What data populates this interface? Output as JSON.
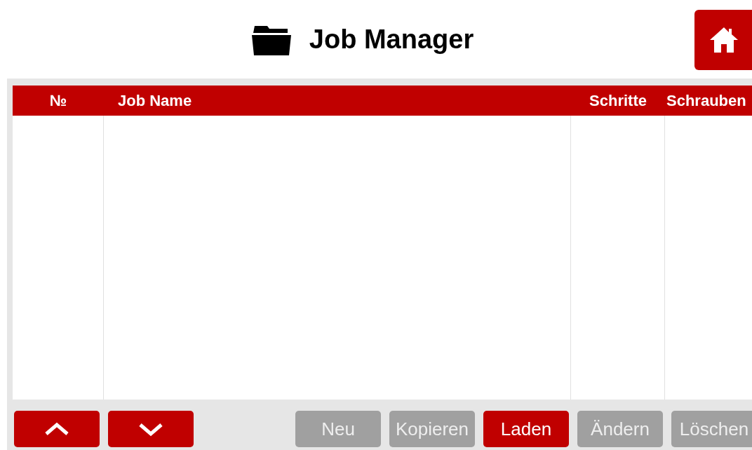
{
  "title": "Job Manager",
  "table": {
    "columns": [
      "№",
      "Job Name",
      "Schritte",
      "Schrauben"
    ]
  },
  "buttons": [
    {
      "kind": "up",
      "disabled": false
    },
    {
      "kind": "down",
      "disabled": false
    },
    {
      "kind": "text",
      "label": "Neu",
      "disabled": true
    },
    {
      "kind": "text",
      "label": "Kopieren",
      "disabled": true
    },
    {
      "kind": "text",
      "label": "Laden",
      "disabled": false
    },
    {
      "kind": "text",
      "label": "Ändern",
      "disabled": true
    },
    {
      "kind": "text",
      "label": "Löschen",
      "disabled": true
    }
  ]
}
